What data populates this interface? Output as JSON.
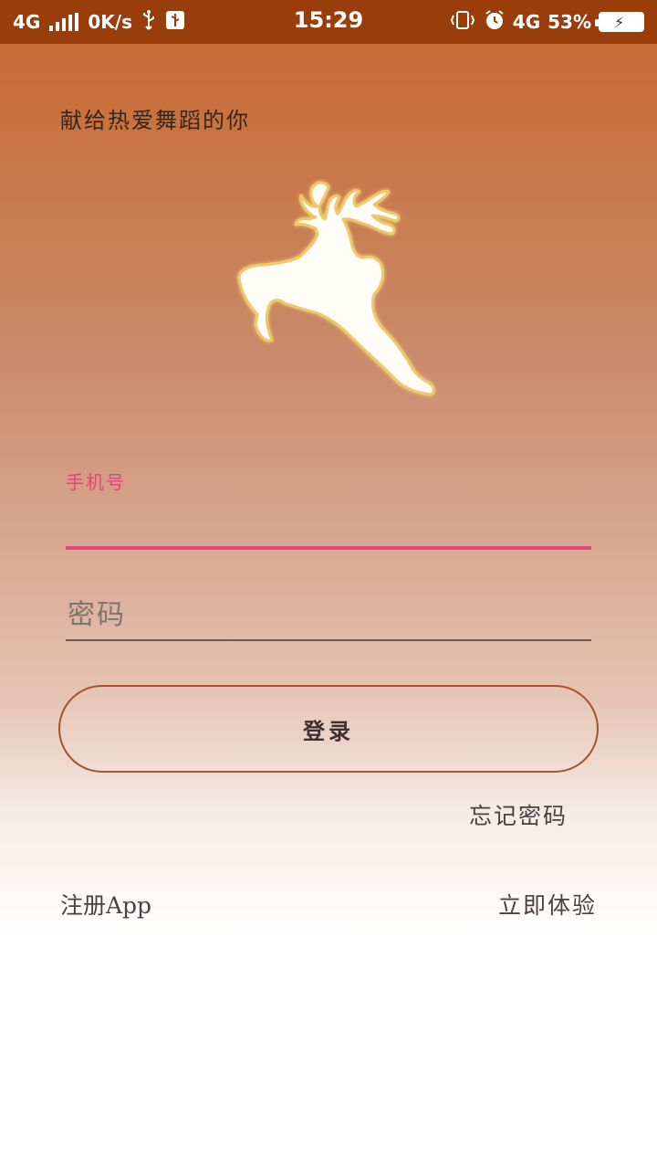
{
  "status_bar": {
    "network_left": "4G",
    "speed": "0K/s",
    "time": "15:29",
    "network_right": "4G",
    "battery": "53%",
    "icons": [
      "signal-icon",
      "usb-icon",
      "usb-debug-icon",
      "vibrate-icon",
      "alarm-icon",
      "battery-charging-icon"
    ]
  },
  "tagline": "献给热爱舞蹈的你",
  "logo": {
    "icon": "leaping-deer-icon"
  },
  "form": {
    "phone_label": "手机号",
    "phone_value": "",
    "password_placeholder": "密码",
    "login_label": "登录"
  },
  "links": {
    "forgot_password": "忘记密码",
    "register": "注册App",
    "try_now": "立即体验"
  },
  "colors": {
    "status_bar": "#993d0b",
    "accent_pink": "#e6467e",
    "button_border": "#a8532a",
    "gradient_top": "#c8662c"
  }
}
